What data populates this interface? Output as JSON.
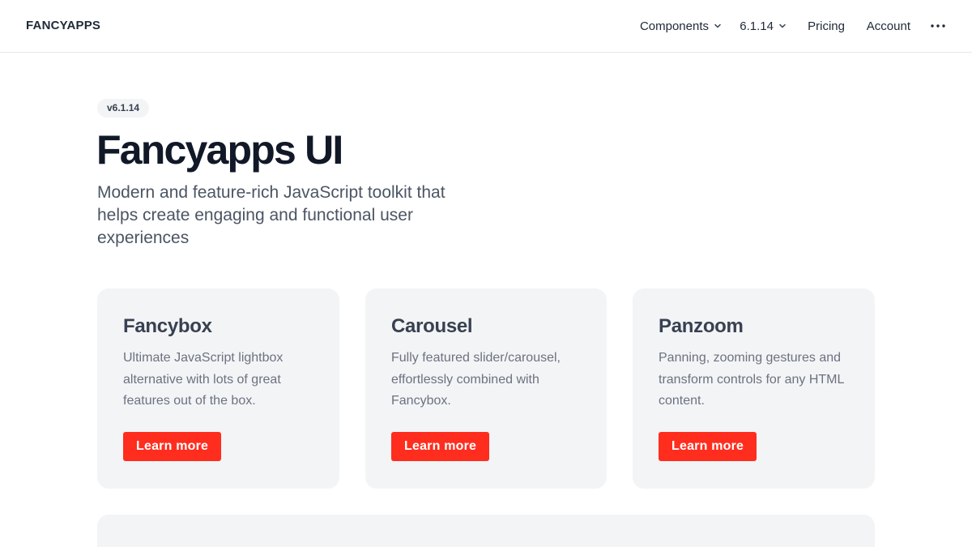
{
  "header": {
    "logo": "FANCYAPPS",
    "nav": {
      "components_label": "Components",
      "version_label": "6.1.14",
      "pricing_label": "Pricing",
      "account_label": "Account"
    },
    "icons": {
      "chevron": "chevron-down-icon",
      "more": "more-horizontal-icon"
    }
  },
  "hero": {
    "badge": "v6.1.14",
    "title": "Fancyapps UI",
    "subtitle": "Modern and feature-rich JavaScript toolkit that helps create engaging and functional user experiences"
  },
  "cards": [
    {
      "title": "Fancybox",
      "description": "Ultimate JavaScript lightbox alternative with lots of great features out of the box.",
      "button": "Learn more"
    },
    {
      "title": "Carousel",
      "description": "Fully featured slider/carousel, effortlessly combined with Fancybox.",
      "button": "Learn more"
    },
    {
      "title": "Panzoom",
      "description": "Panning, zooming gestures and transform controls for any HTML content.",
      "button": "Learn more"
    }
  ],
  "colors": {
    "accent": "#ff2d1e",
    "card_bg": "#f3f4f6",
    "title_text": "#111827",
    "muted_text": "#6b7280"
  }
}
